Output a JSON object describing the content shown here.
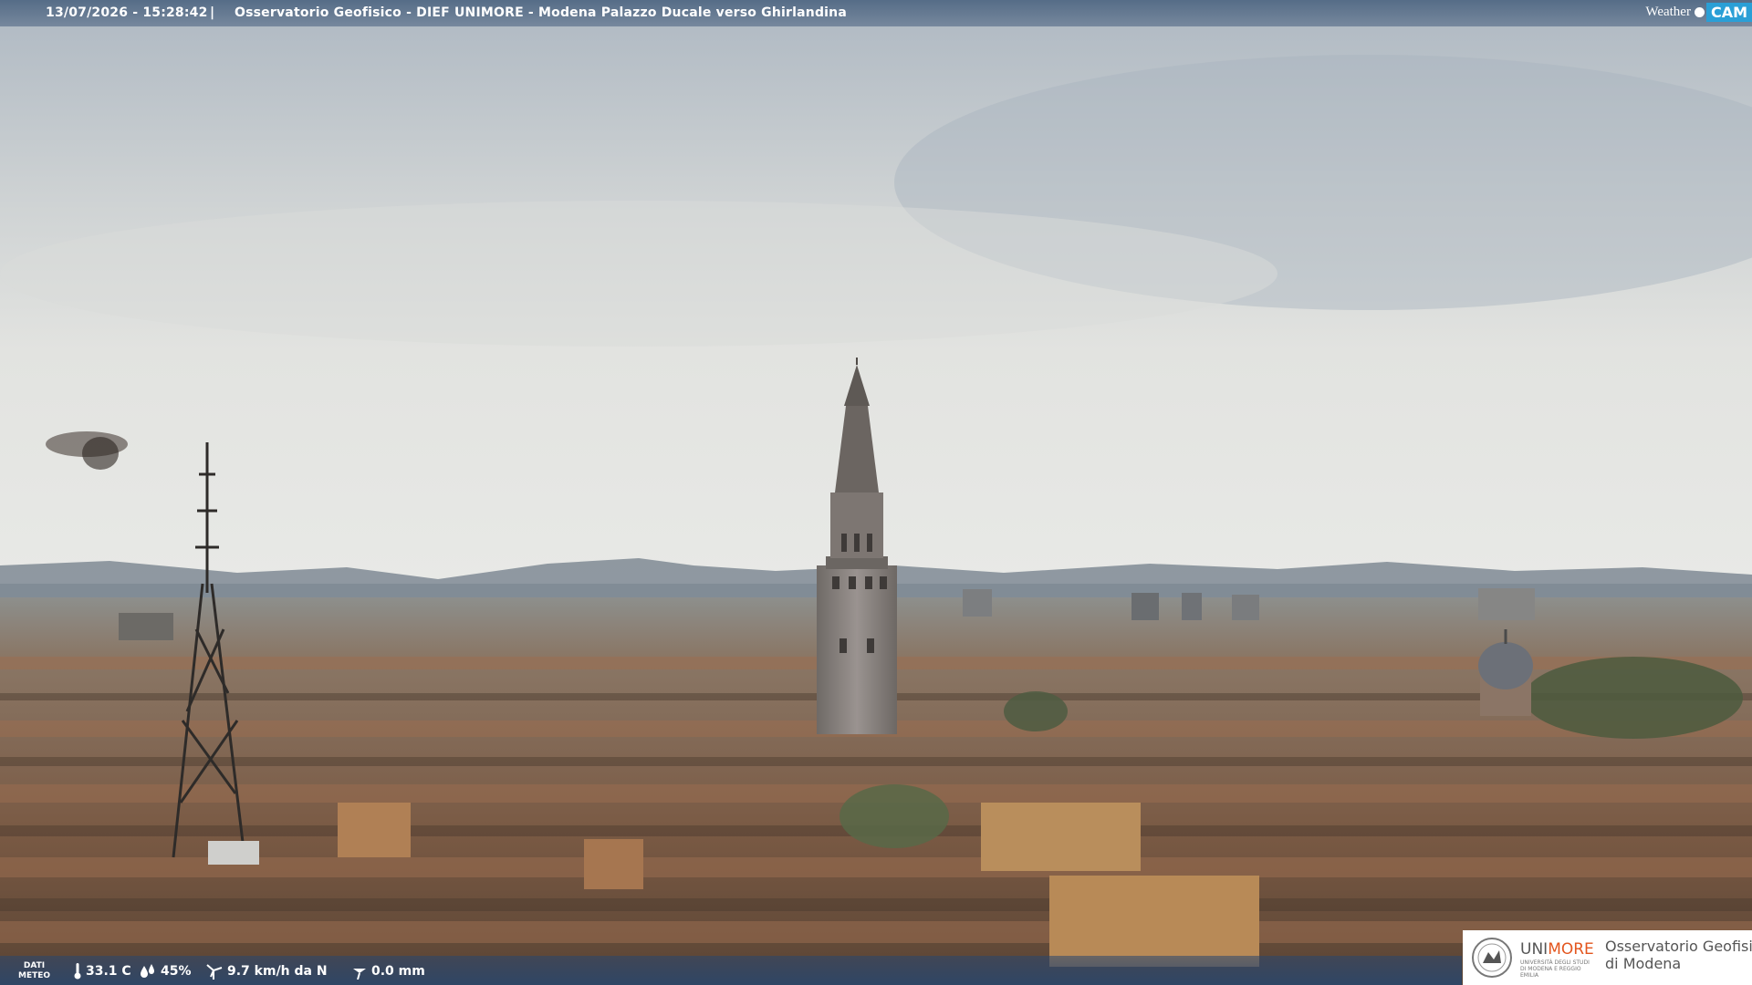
{
  "overlay": {
    "timestamp": "13/07/2026 - 15:28:42",
    "separator": "|",
    "title": "Osservatorio Geofisico - DIEF UNIMORE - Modena Palazzo Ducale verso Ghirlandina",
    "brand_weather": "Weather",
    "brand_cam": "CAM"
  },
  "weather": {
    "label_line1": "DATI",
    "label_line2": "METEO",
    "temperature": "33.1 C",
    "humidity": "45%",
    "wind": "9.7 km/h da N",
    "rain": "0.0 mm"
  },
  "logo": {
    "uni_a": "UNI",
    "uni_b": "MORE",
    "uni_sub": "UNIVERSITÀ DEGLI STUDI DI MODENA E REGGIO EMILIA",
    "obs_line1": "Osservatorio Geofisico",
    "obs_line2": "di Modena"
  },
  "colors": {
    "sky_top": "#b4bcc4",
    "sky_bottom": "#e6e7e5",
    "roofs": "#8a6a52",
    "accent_more": "#e3561f",
    "cam_blue": "#2a9fd6"
  }
}
